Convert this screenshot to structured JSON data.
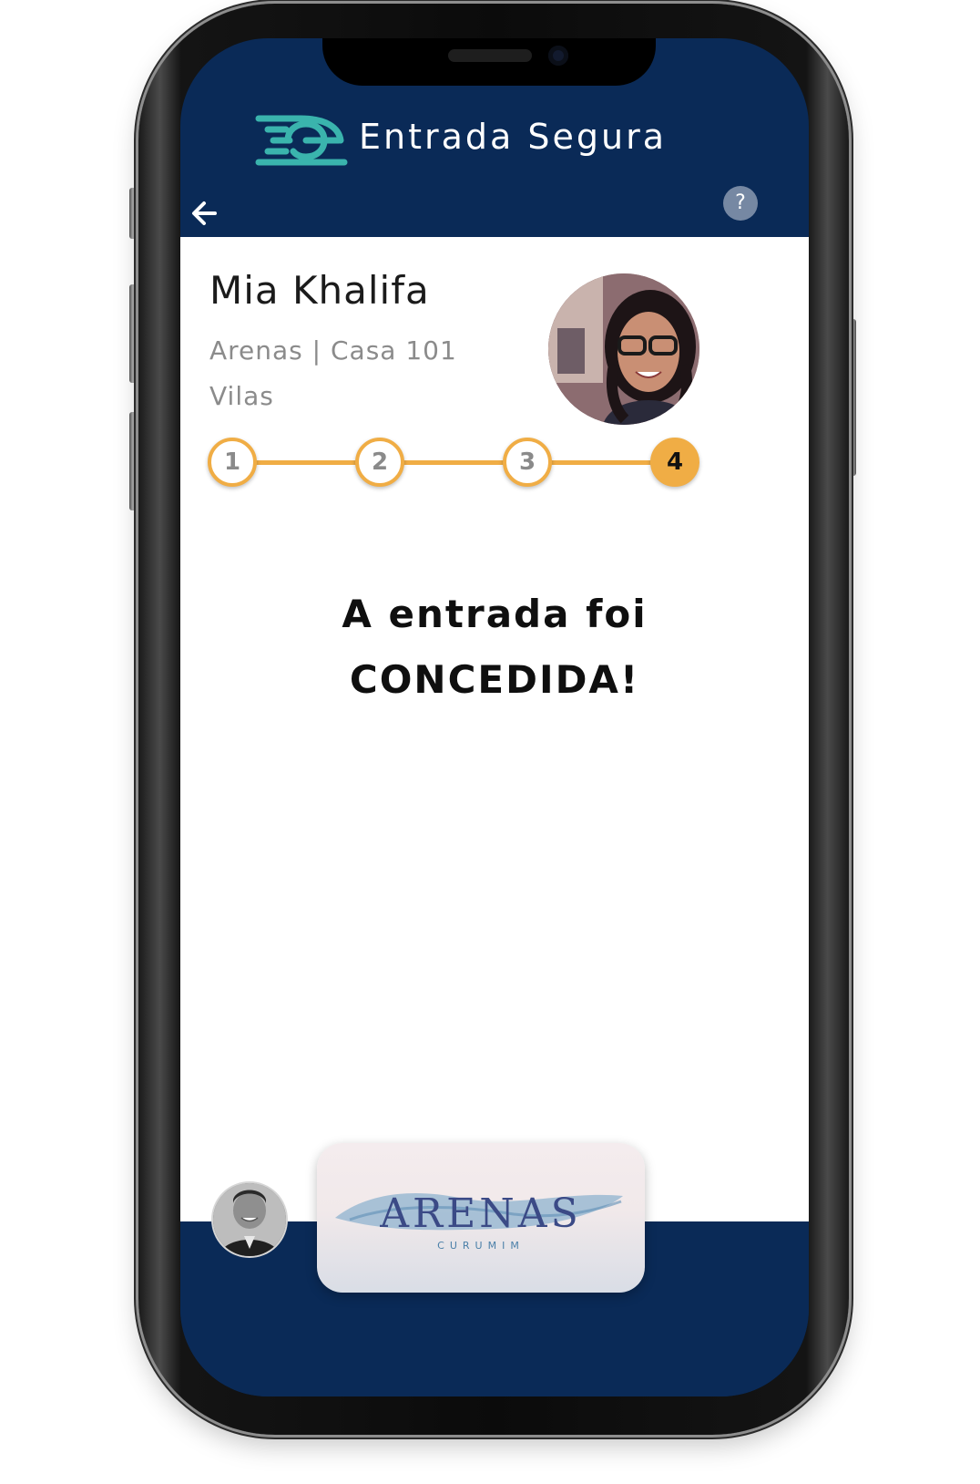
{
  "app": {
    "brand_name": "Entrada Segura",
    "accent_color": "#f0ad45",
    "header_color": "#0a2a57",
    "logo_color": "#3ab4ad"
  },
  "header": {
    "back_icon": "arrow-left-icon",
    "help_label": "?"
  },
  "visitor": {
    "name": "Mia Khalifa",
    "location": "Arenas | Casa 101",
    "area": "Vilas"
  },
  "stepper": {
    "steps": [
      "1",
      "2",
      "3",
      "4"
    ],
    "current": 4
  },
  "status": {
    "line1": "A entrada foi",
    "line2": "CONCEDIDA!"
  },
  "condominium": {
    "name": "ARENAS",
    "subtitle": "CURUMIM"
  }
}
